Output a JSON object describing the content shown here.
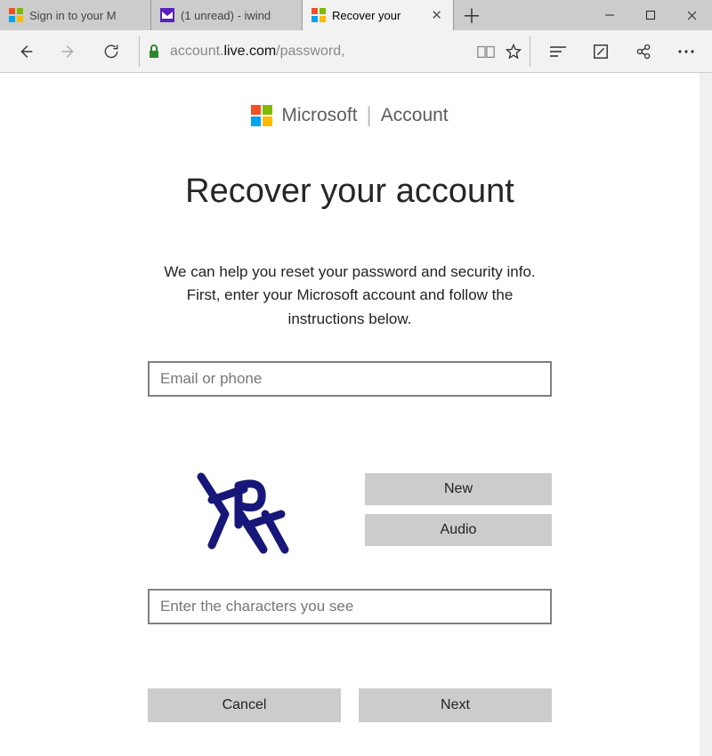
{
  "tabs": [
    {
      "title": "Sign in to your M",
      "favicon": "ms-logo"
    },
    {
      "title": "(1 unread) - iwind",
      "favicon": "mail-icon"
    },
    {
      "title": "Recover your",
      "favicon": "ms-logo",
      "active": true
    }
  ],
  "address": {
    "prefix": "account.",
    "host": "live.com",
    "suffix": "/password,"
  },
  "brand": {
    "name": "Microsoft",
    "section": "Account"
  },
  "page": {
    "title": "Recover your account",
    "instructions": "We can help you reset your password and security info. First, enter your Microsoft account and follow the instructions below.",
    "email_placeholder": "Email or phone",
    "captcha_placeholder": "Enter the characters you see",
    "captcha_new": "New",
    "captcha_audio": "Audio",
    "cancel": "Cancel",
    "next": "Next"
  }
}
